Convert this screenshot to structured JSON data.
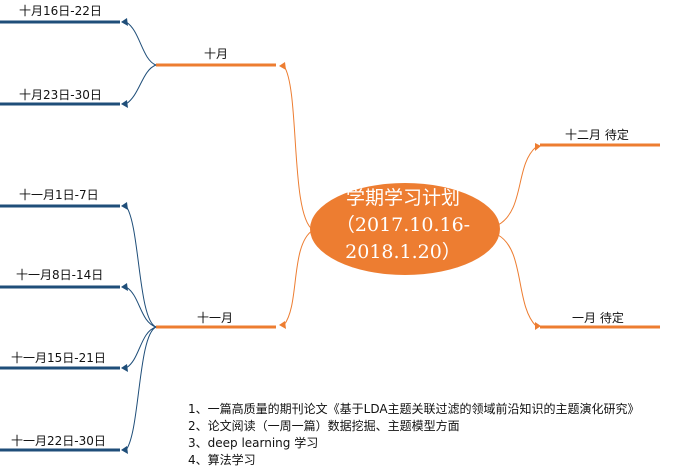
{
  "diagram": {
    "center": {
      "lines": [
        "学期学习计划",
        "（2017.10.16-",
        "2018.1.20）"
      ],
      "color": "#ed7d31",
      "text_color": "#ffffff"
    },
    "branches": {
      "october": {
        "label": "十月",
        "children": [
          "十月16日-22日",
          "十月23日-30日"
        ]
      },
      "november": {
        "label": "十一月",
        "children": [
          "十一月1日-7日",
          "十一月8日-14日",
          "十一月15日-21日",
          "十一月22日-30日"
        ]
      },
      "december": {
        "label": "十二月 待定"
      },
      "january": {
        "label": "一月 待定"
      }
    },
    "notes": [
      "1、一篇高质量的期刊论文《基于LDA主题关联过滤的领域前沿知识的主题演化研究》",
      "2、论文阅读（一周一篇）数据挖掘、主题模型方面",
      "3、deep learning 学习",
      "4、算法学习"
    ],
    "colors": {
      "branch_line": "#ed7d31",
      "leaf_line": "#1f4e79",
      "connector": "#1f4e79"
    }
  }
}
